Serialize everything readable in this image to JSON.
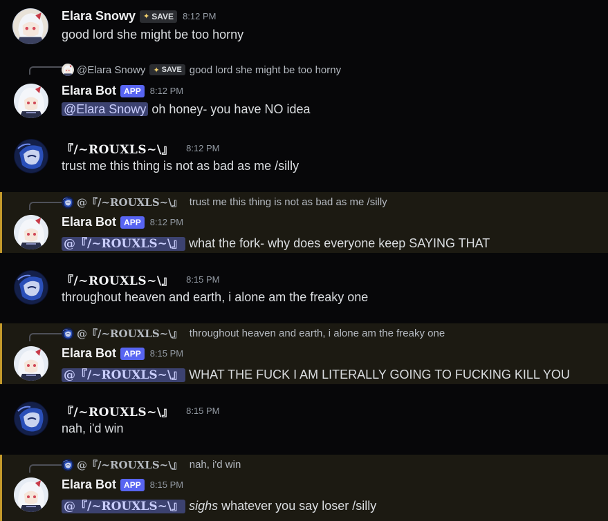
{
  "colors": {
    "bg": "#070709",
    "mention_bg": "#1c1a12",
    "mention_bar": "#c49a2b",
    "app_badge": "#5865f2",
    "pill_bg": "#3c4270"
  },
  "messages": [
    {
      "author": "Elara Snowy",
      "badge": "SAVE",
      "time": "8:12 PM",
      "text": "good lord she might be too horny"
    },
    {
      "reply": {
        "user": "@Elara Snowy",
        "badge": "SAVE",
        "text": "good lord she might be too horny"
      },
      "author": "Elara Bot",
      "badge": "APP",
      "time": "8:12 PM",
      "mention": "@Elara Snowy",
      "text": "oh honey- you have NO idea"
    },
    {
      "author": "『/~ROUXLS~\\』",
      "time": "8:12 PM",
      "text": "trust me this thing is not as bad as me /silly"
    },
    {
      "reply": {
        "user": "@『/~ROUXLS~\\』",
        "text": "trust me this thing is not as bad as me /silly"
      },
      "author": "Elara Bot",
      "badge": "APP",
      "time": "8:12 PM",
      "mention": "@『/~ROUXLS~\\』",
      "text": "what the fork- why does everyone keep SAYING THAT"
    },
    {
      "author": "『/~ROUXLS~\\』",
      "time": "8:15 PM",
      "text": "throughout heaven and earth, i alone am the freaky one"
    },
    {
      "reply": {
        "user": "@『/~ROUXLS~\\』",
        "text": "throughout heaven and earth, i alone am the freaky one"
      },
      "author": "Elara Bot",
      "badge": "APP",
      "time": "8:15 PM",
      "mention": "@『/~ROUXLS~\\』",
      "text": "WHAT THE FUCK I AM LITERALLY GOING TO FUCKING KILL YOU"
    },
    {
      "author": "『/~ROUXLS~\\』",
      "time": "8:15 PM",
      "text": "nah, i'd win"
    },
    {
      "reply": {
        "user": "@『/~ROUXLS~\\』",
        "text": "nah, i'd win"
      },
      "author": "Elara Bot",
      "badge": "APP",
      "time": "8:15 PM",
      "mention": "@『/~ROUXLS~\\』",
      "italic": "sighs",
      "text": " whatever you say loser /silly"
    }
  ]
}
